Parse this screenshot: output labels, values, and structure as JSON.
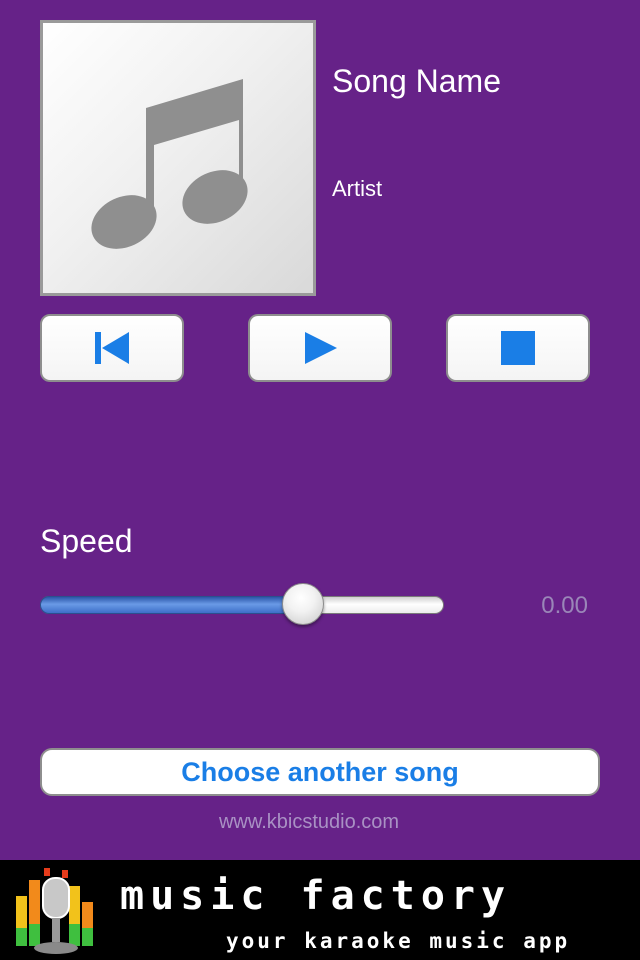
{
  "track": {
    "song_name": "Song Name",
    "artist": "Artist",
    "artwork_icon": "music-note-icon"
  },
  "controls": {
    "previous_icon": "skip-previous-icon",
    "play_icon": "play-icon",
    "stop_icon": "stop-icon"
  },
  "speed": {
    "label": "Speed",
    "value": "0.00",
    "slider_position": 0.65,
    "fill_color": "#3d6fc8"
  },
  "choose_button": {
    "label": "Choose another song"
  },
  "footer": {
    "website": "www.kbicstudio.com"
  },
  "ad_banner": {
    "title": "music factory",
    "subtitle": "your karaoke music app",
    "logo_icon": "microphone-equalizer-icon"
  },
  "colors": {
    "background": "#662288",
    "accent": "#1a7ee6",
    "control_icon": "#1a7ee6"
  }
}
